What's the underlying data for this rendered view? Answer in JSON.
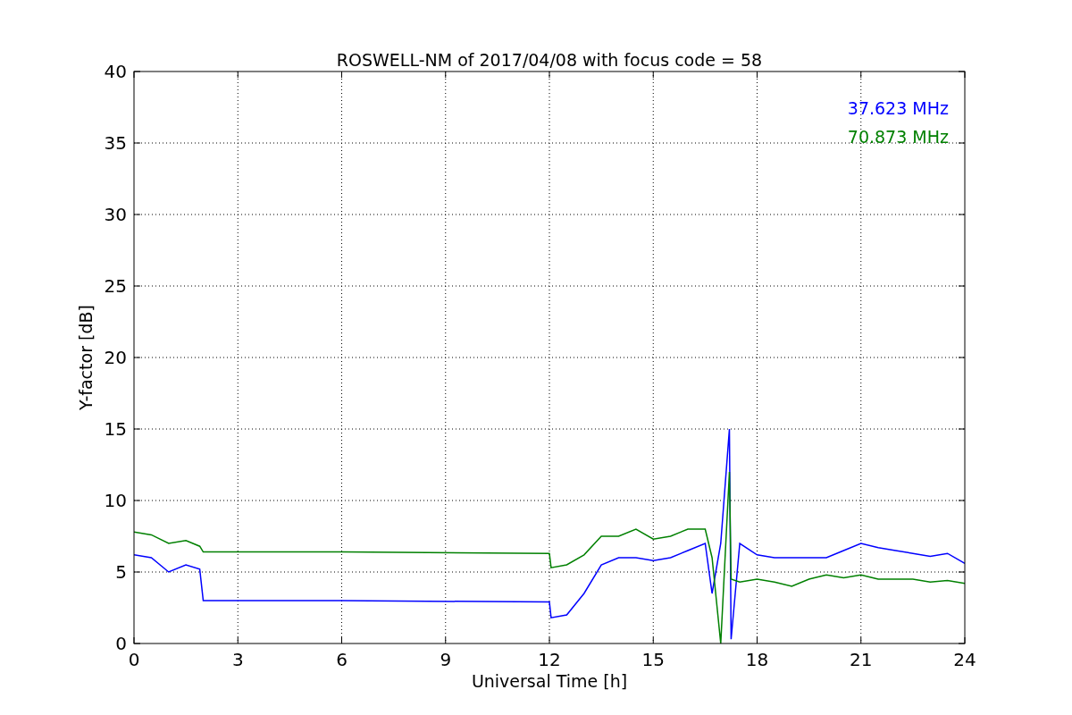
{
  "chart": {
    "chart_data": {
      "type": "line",
      "title": "ROSWELL-NM of 2017/04/08 with focus code = 58",
      "xlabel": "Universal Time [h]",
      "ylabel": "Y-factor [dB]",
      "x": [
        0,
        0.5,
        1,
        1.5,
        1.9,
        2,
        6,
        12,
        12.05,
        12.5,
        13,
        13.5,
        14,
        14.5,
        15,
        15.5,
        16,
        16.5,
        16.7,
        16.95,
        17.2,
        17.25,
        17.5,
        18,
        18.5,
        19,
        19.5,
        20,
        20.5,
        21,
        21.5,
        22,
        22.5,
        23,
        23.5,
        24
      ],
      "series": [
        {
          "name": "37.623 MHz",
          "color": "#0000ff",
          "values": [
            6.2,
            6.0,
            5.0,
            5.5,
            5.2,
            3.0,
            3.0,
            2.9,
            1.8,
            2.0,
            3.5,
            5.5,
            6.0,
            6.0,
            5.8,
            6.0,
            6.5,
            7.0,
            3.5,
            7.0,
            15.0,
            0.3,
            7.0,
            6.2,
            6.0,
            6.0,
            6.0,
            6.0,
            6.5,
            7.0,
            6.7,
            6.5,
            6.3,
            6.1,
            6.3,
            5.6
          ]
        },
        {
          "name": "70.873 MHz",
          "color": "#008000",
          "values": [
            7.8,
            7.6,
            7.0,
            7.2,
            6.8,
            6.4,
            6.4,
            6.3,
            5.3,
            5.5,
            6.2,
            7.5,
            7.5,
            8.0,
            7.3,
            7.5,
            8.0,
            8.0,
            6.0,
            0,
            12.0,
            4.5,
            4.3,
            4.5,
            4.3,
            4.0,
            4.5,
            4.8,
            4.6,
            4.8,
            4.5,
            4.5,
            4.5,
            4.3,
            4.4,
            4.2
          ]
        }
      ],
      "xlim": [
        0,
        24
      ],
      "ylim": [
        0,
        40
      ],
      "xticks": [
        0,
        3,
        6,
        9,
        12,
        15,
        18,
        21,
        24
      ],
      "yticks": [
        0,
        5,
        10,
        15,
        20,
        25,
        30,
        35,
        40
      ],
      "grid": true
    }
  }
}
